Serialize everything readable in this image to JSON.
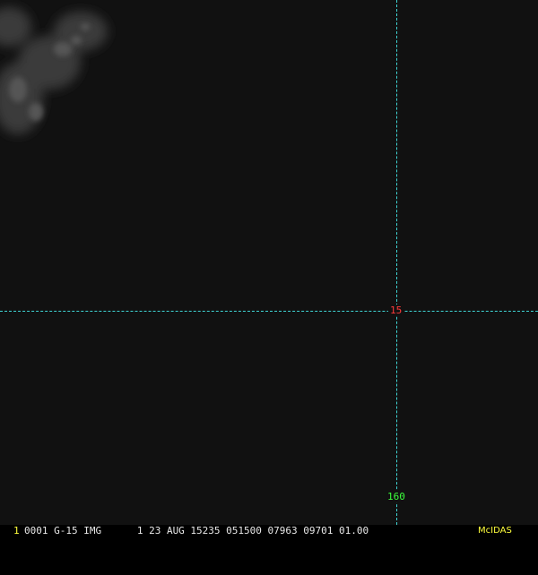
{
  "colors": {
    "background": "#111111",
    "grid_line": "#3fd6d6",
    "latitude_label": "#ff3b3b",
    "longitude_label": "#3cff3c",
    "status_text": "#e8e8e8",
    "frame_number": "#ffff3c",
    "brand": "#ffff3c"
  },
  "map": {
    "latitude_label": "15",
    "longitude_label": "160"
  },
  "status_bar": {
    "frame_number": "1",
    "info": "0001 G-15 IMG      1 23 AUG 15235 051500 07963 09701 01.00",
    "brand": "McIDAS"
  }
}
